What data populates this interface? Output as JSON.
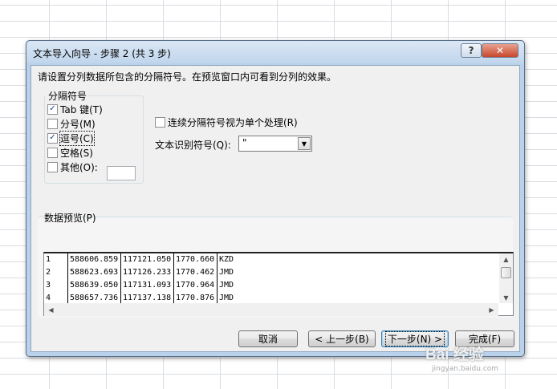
{
  "dialog": {
    "title": "文本导入向导 - 步骤 2 (共 3 步)",
    "help_glyph": "?",
    "close_glyph": "✕",
    "instruction": "请设置分列数据所包含的分隔符号。在预览窗口内可看到分列的效果。"
  },
  "delimiters": {
    "group_label": "分隔符号",
    "items": [
      {
        "label": "Tab 键(T)",
        "checked": true
      },
      {
        "label": "分号(M)",
        "checked": false
      },
      {
        "label": "逗号(C)",
        "checked": true
      },
      {
        "label": "空格(S)",
        "checked": false
      },
      {
        "label": "其他(O):",
        "checked": false
      }
    ],
    "other_value": ""
  },
  "options": {
    "consecutive_label": "连续分隔符号视为单个处理(R)",
    "consecutive_checked": false,
    "qualifier_label": "文本识别符号(Q):",
    "qualifier_value": "\""
  },
  "preview": {
    "label": "数据预览(P)",
    "rows": [
      [
        "1",
        "588606.859",
        "117121.050",
        "1770.660",
        "KZD"
      ],
      [
        "2",
        "588623.693",
        "117126.233",
        "1770.462",
        "JMD"
      ],
      [
        "3",
        "588639.050",
        "117131.093",
        "1770.964",
        "JMD"
      ],
      [
        "4",
        "588657.736",
        "117137.138",
        "1770.876",
        "JMD"
      ]
    ]
  },
  "buttons": {
    "cancel": "取消",
    "back": "< 上一步(B)",
    "next": "下一步(N) >",
    "finish": "完成(F)"
  },
  "watermark": {
    "brand": "Bai 经验",
    "url": "jingyan.baidu.com"
  }
}
